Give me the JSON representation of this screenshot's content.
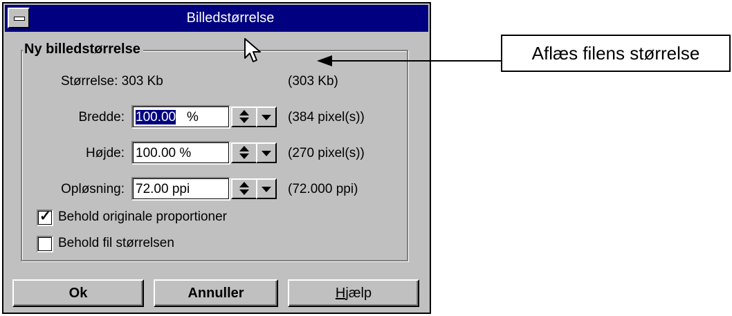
{
  "window": {
    "title": "Billedstørrelse"
  },
  "group": {
    "title": "Ny billedstørrelse"
  },
  "size": {
    "label": "Størrelse: 303 Kb",
    "value": "(303 Kb)"
  },
  "width": {
    "label": "Bredde:",
    "value": "100.00",
    "unit": "%",
    "pixels": "(384 pixel(s))"
  },
  "height": {
    "label": "Højde:",
    "value": "100.00 %",
    "pixels": "(270 pixel(s))"
  },
  "resolution": {
    "label": "Opløsning:",
    "value": "72.00 ppi",
    "ppi": "(72.000 ppi)"
  },
  "checkboxes": {
    "keep_proportions": {
      "label": "Behold originale proportioner",
      "checked": true
    },
    "keep_filesize": {
      "label": "Behold fil størrelsen",
      "checked": false
    }
  },
  "buttons": {
    "ok": "Ok",
    "cancel": "Annuller",
    "help_prefix": "H",
    "help_rest": "jælp"
  },
  "annotation": {
    "text": "Aflæs filens størrelse"
  },
  "icons": {
    "system_menu": "system-menu-icon",
    "cursor": "mouse-cursor-icon",
    "spin": "spin-updown-icon",
    "dropdown": "chevron-down-icon",
    "check": "checkmark-icon"
  },
  "colors": {
    "titlebar": "#000080",
    "dialog_bg": "#c0c0c0",
    "selection": "#000080"
  }
}
